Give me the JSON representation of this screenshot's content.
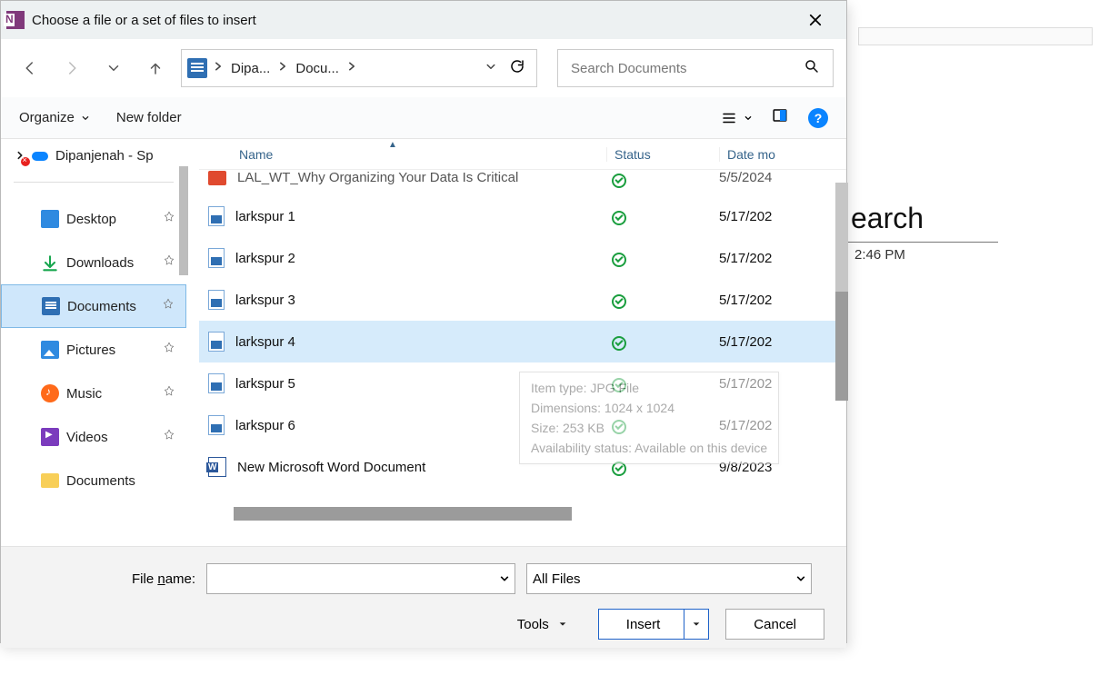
{
  "titlebar": {
    "title": "Choose a file or a set of files to insert"
  },
  "nav": {
    "breadcrumb": [
      "Dipa...",
      "Docu..."
    ],
    "search_placeholder": "Search Documents"
  },
  "toolbar": {
    "organize": "Organize",
    "new_folder": "New folder"
  },
  "tree": {
    "account": "Dipanjenah - Sp",
    "items": [
      {
        "label": "Desktop",
        "icon": "desktop",
        "pinned": true
      },
      {
        "label": "Downloads",
        "icon": "dl",
        "pinned": true
      },
      {
        "label": "Documents",
        "icon": "docs",
        "pinned": true,
        "selected": true
      },
      {
        "label": "Pictures",
        "icon": "pics",
        "pinned": true
      },
      {
        "label": "Music",
        "icon": "music",
        "pinned": true
      },
      {
        "label": "Videos",
        "icon": "vid",
        "pinned": true
      },
      {
        "label": "Documents",
        "icon": "folder",
        "pinned": false
      }
    ]
  },
  "columns": {
    "name": "Name",
    "status": "Status",
    "date": "Date mo"
  },
  "files": [
    {
      "name": "LAL_WT_Why Organizing Your Data Is Critical",
      "date": "5/5/2024",
      "icon": "other",
      "cut": true
    },
    {
      "name": "larkspur 1",
      "date": "5/17/202",
      "icon": "img"
    },
    {
      "name": "larkspur 2",
      "date": "5/17/202",
      "icon": "img"
    },
    {
      "name": "larkspur 3",
      "date": "5/17/202",
      "icon": "img"
    },
    {
      "name": "larkspur 4",
      "date": "5/17/202",
      "icon": "img",
      "selected": true
    },
    {
      "name": "larkspur 5",
      "date": "5/17/202",
      "icon": "img"
    },
    {
      "name": "larkspur 6",
      "date": "5/17/202",
      "icon": "img"
    },
    {
      "name": "New Microsoft Word Document",
      "date": "9/8/2023",
      "icon": "word"
    }
  ],
  "tooltip": {
    "line1": "Item type: JPG File",
    "line2": "Dimensions: 1024 x 1024",
    "line3": "Size: 253 KB",
    "line4": "Availability status: Available on this device"
  },
  "footer": {
    "file_name_label_pre": "File ",
    "file_name_label_u": "n",
    "file_name_label_post": "ame:",
    "file_name_value": "",
    "filter": "All Files",
    "tools": "Tools",
    "insert": "Insert",
    "cancel": "Cancel"
  },
  "background": {
    "title_fragment": "earch",
    "timestamp": "2:46 PM"
  }
}
